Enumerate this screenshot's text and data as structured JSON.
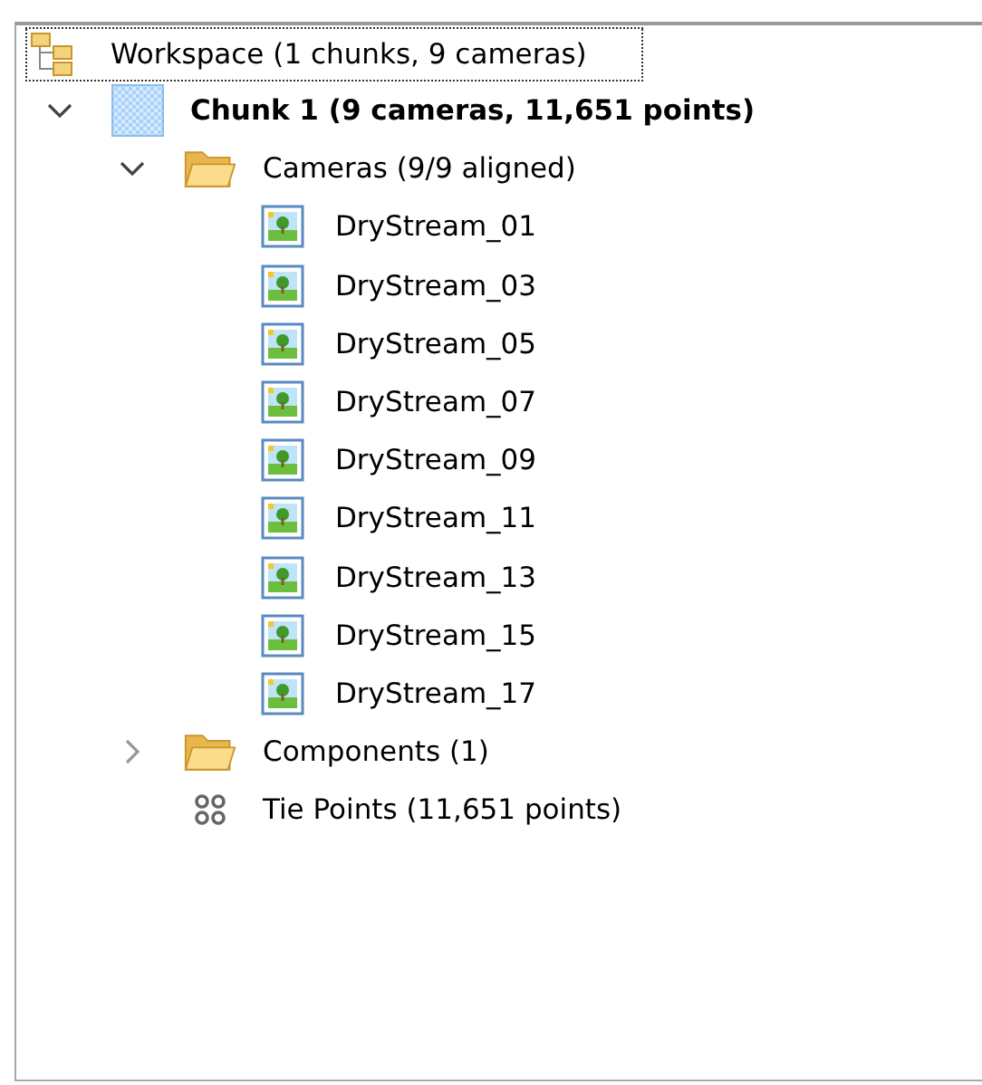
{
  "workspace": {
    "label": "Workspace (1 chunks, 9 cameras)",
    "focused": true,
    "children": [
      {
        "label": "Chunk 1 (9 cameras, 11,651 points)",
        "kind": "chunk",
        "expanded": true,
        "children": [
          {
            "label": "Cameras (9/9 aligned)",
            "kind": "folder",
            "expanded": true,
            "children": [
              {
                "label": "DryStream_01",
                "kind": "camera"
              },
              {
                "label": "DryStream_03",
                "kind": "camera"
              },
              {
                "label": "DryStream_05",
                "kind": "camera"
              },
              {
                "label": "DryStream_07",
                "kind": "camera"
              },
              {
                "label": "DryStream_09",
                "kind": "camera"
              },
              {
                "label": "DryStream_11",
                "kind": "camera"
              },
              {
                "label": "DryStream_13",
                "kind": "camera"
              },
              {
                "label": "DryStream_15",
                "kind": "camera"
              },
              {
                "label": "DryStream_17",
                "kind": "camera"
              }
            ]
          },
          {
            "label": "Components (1)",
            "kind": "folder",
            "expanded": false
          },
          {
            "label": "Tie Points (11,651 points)",
            "kind": "points"
          }
        ]
      }
    ]
  }
}
